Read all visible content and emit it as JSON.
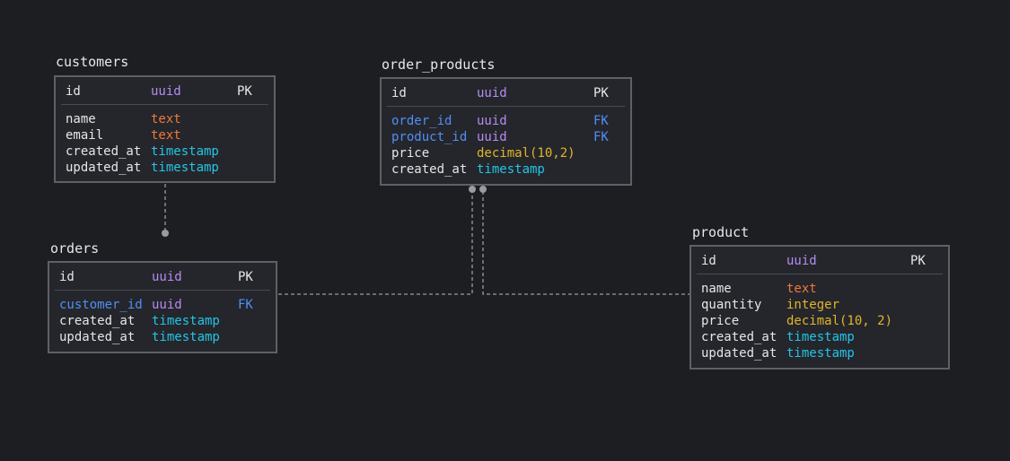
{
  "tables": {
    "customers": {
      "title": "customers",
      "pk": {
        "name": "id",
        "type": "uuid",
        "key": "PK"
      },
      "columns": [
        {
          "name": "name",
          "type": "text",
          "key": ""
        },
        {
          "name": "email",
          "type": "text",
          "key": ""
        },
        {
          "name": "created_at",
          "type": "timestamp",
          "key": ""
        },
        {
          "name": "updated_at",
          "type": "timestamp",
          "key": ""
        }
      ]
    },
    "orders": {
      "title": "orders",
      "pk": {
        "name": "id",
        "type": "uuid",
        "key": "PK"
      },
      "columns": [
        {
          "name": "customer_id",
          "type": "uuid",
          "key": "FK"
        },
        {
          "name": "created_at",
          "type": "timestamp",
          "key": ""
        },
        {
          "name": "updated_at",
          "type": "timestamp",
          "key": ""
        }
      ]
    },
    "order_products": {
      "title": "order_products",
      "pk": {
        "name": "id",
        "type": "uuid",
        "key": "PK"
      },
      "columns": [
        {
          "name": "order_id",
          "type": "uuid",
          "key": "FK"
        },
        {
          "name": "product_id",
          "type": "uuid",
          "key": "FK"
        },
        {
          "name": "price",
          "type": "decimal(10,2)",
          "key": ""
        },
        {
          "name": "created_at",
          "type": "timestamp",
          "key": ""
        }
      ]
    },
    "product": {
      "title": "product",
      "pk": {
        "name": "id",
        "type": "uuid",
        "key": "PK"
      },
      "columns": [
        {
          "name": "name",
          "type": "text",
          "key": ""
        },
        {
          "name": "quantity",
          "type": "integer",
          "key": ""
        },
        {
          "name": "price",
          "type": "decimal(10, 2)",
          "key": ""
        },
        {
          "name": "created_at",
          "type": "timestamp",
          "key": ""
        },
        {
          "name": "updated_at",
          "type": "timestamp",
          "key": ""
        }
      ]
    }
  },
  "colors": {
    "background": "#1d1e22",
    "table_bg": "#25262b",
    "border": "#5f6066",
    "uuid": "#b48cf2",
    "text": "#f0773a",
    "timestamp": "#22c5e8",
    "decimal": "#e0b52b",
    "fk": "#4f8ff7",
    "connector": "#9a9ba0"
  }
}
